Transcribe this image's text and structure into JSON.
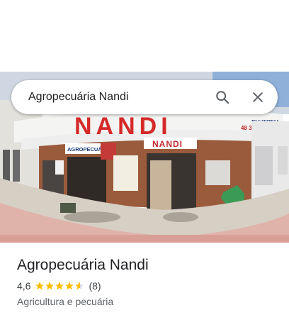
{
  "search": {
    "query": "Agropecuária Nandi"
  },
  "icons": {
    "search": "search-icon",
    "close": "close-icon"
  },
  "photo": {
    "sign_main": "NANDI",
    "sign_left": "AGROPECUÁRIA",
    "sign_center": "NANDI",
    "sign_right_1": "TELE-ENTREGA",
    "sign_right_2": "48 3626-0807"
  },
  "place": {
    "name": "Agropecuária Nandi",
    "rating": "4,6",
    "rating_value": 4.6,
    "review_count": "(8)",
    "category": "Agricultura e pecuária"
  },
  "colors": {
    "star": "#fbbc04",
    "star_empty": "#dadce0",
    "text": "#202124"
  }
}
